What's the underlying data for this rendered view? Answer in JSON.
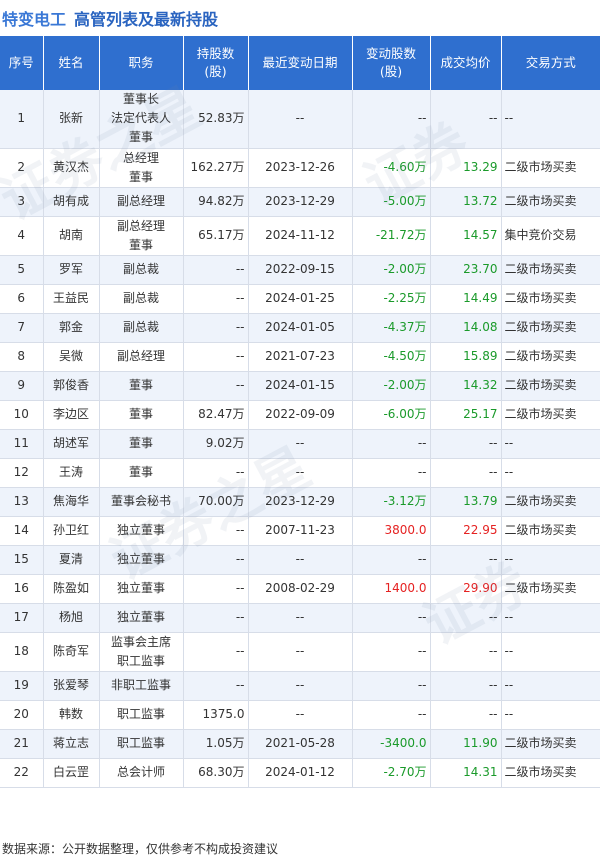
{
  "header": {
    "company": "特变电工",
    "subtitle": "高管列表及最新持股"
  },
  "columns": [
    "序号",
    "姓名",
    "职务",
    "持股数\n(股)",
    "最近变动日期",
    "变动股数\n(股)",
    "成交均价",
    "交易方式"
  ],
  "rows": [
    {
      "no": "1",
      "name": "张新",
      "role": "董事长\n法定代表人\n董事",
      "shares": "52.83万",
      "date": "--",
      "change": "--",
      "price": "--",
      "method": "--",
      "dir": ""
    },
    {
      "no": "2",
      "name": "黄汉杰",
      "role": "总经理\n董事",
      "shares": "162.27万",
      "date": "2023-12-26",
      "change": "-4.60万",
      "price": "13.29",
      "method": "二级市场买卖",
      "dir": "down"
    },
    {
      "no": "3",
      "name": "胡有成",
      "role": "副总经理",
      "shares": "94.82万",
      "date": "2023-12-29",
      "change": "-5.00万",
      "price": "13.72",
      "method": "二级市场买卖",
      "dir": "down"
    },
    {
      "no": "4",
      "name": "胡南",
      "role": "副总经理\n董事",
      "shares": "65.17万",
      "date": "2024-11-12",
      "change": "-21.72万",
      "price": "14.57",
      "method": "集中竞价交易",
      "dir": "down"
    },
    {
      "no": "5",
      "name": "罗军",
      "role": "副总裁",
      "shares": "--",
      "date": "2022-09-15",
      "change": "-2.00万",
      "price": "23.70",
      "method": "二级市场买卖",
      "dir": "down"
    },
    {
      "no": "6",
      "name": "王益民",
      "role": "副总裁",
      "shares": "--",
      "date": "2024-01-25",
      "change": "-2.25万",
      "price": "14.49",
      "method": "二级市场买卖",
      "dir": "down"
    },
    {
      "no": "7",
      "name": "郭金",
      "role": "副总裁",
      "shares": "--",
      "date": "2024-01-05",
      "change": "-4.37万",
      "price": "14.08",
      "method": "二级市场买卖",
      "dir": "down"
    },
    {
      "no": "8",
      "name": "吴微",
      "role": "副总经理",
      "shares": "--",
      "date": "2021-07-23",
      "change": "-4.50万",
      "price": "15.89",
      "method": "二级市场买卖",
      "dir": "down"
    },
    {
      "no": "9",
      "name": "郭俊香",
      "role": "董事",
      "shares": "--",
      "date": "2024-01-15",
      "change": "-2.00万",
      "price": "14.32",
      "method": "二级市场买卖",
      "dir": "down"
    },
    {
      "no": "10",
      "name": "李边区",
      "role": "董事",
      "shares": "82.47万",
      "date": "2022-09-09",
      "change": "-6.00万",
      "price": "25.17",
      "method": "二级市场买卖",
      "dir": "down"
    },
    {
      "no": "11",
      "name": "胡述军",
      "role": "董事",
      "shares": "9.02万",
      "date": "--",
      "change": "--",
      "price": "--",
      "method": "--",
      "dir": ""
    },
    {
      "no": "12",
      "name": "王涛",
      "role": "董事",
      "shares": "--",
      "date": "--",
      "change": "--",
      "price": "--",
      "method": "--",
      "dir": ""
    },
    {
      "no": "13",
      "name": "焦海华",
      "role": "董事会秘书",
      "shares": "70.00万",
      "date": "2023-12-29",
      "change": "-3.12万",
      "price": "13.79",
      "method": "二级市场买卖",
      "dir": "down"
    },
    {
      "no": "14",
      "name": "孙卫红",
      "role": "独立董事",
      "shares": "--",
      "date": "2007-11-23",
      "change": "3800.0",
      "price": "22.95",
      "method": "二级市场买卖",
      "dir": "up"
    },
    {
      "no": "15",
      "name": "夏清",
      "role": "独立董事",
      "shares": "--",
      "date": "--",
      "change": "--",
      "price": "--",
      "method": "--",
      "dir": ""
    },
    {
      "no": "16",
      "name": "陈盈如",
      "role": "独立董事",
      "shares": "--",
      "date": "2008-02-29",
      "change": "1400.0",
      "price": "29.90",
      "method": "二级市场买卖",
      "dir": "up"
    },
    {
      "no": "17",
      "name": "杨旭",
      "role": "独立董事",
      "shares": "--",
      "date": "--",
      "change": "--",
      "price": "--",
      "method": "--",
      "dir": ""
    },
    {
      "no": "18",
      "name": "陈奇军",
      "role": "监事会主席\n职工监事",
      "shares": "--",
      "date": "--",
      "change": "--",
      "price": "--",
      "method": "--",
      "dir": ""
    },
    {
      "no": "19",
      "name": "张爱琴",
      "role": "非职工监事",
      "shares": "--",
      "date": "--",
      "change": "--",
      "price": "--",
      "method": "--",
      "dir": ""
    },
    {
      "no": "20",
      "name": "韩数",
      "role": "职工监事",
      "shares": "1375.0",
      "date": "--",
      "change": "--",
      "price": "--",
      "method": "--",
      "dir": ""
    },
    {
      "no": "21",
      "name": "蒋立志",
      "role": "职工监事",
      "shares": "1.05万",
      "date": "2021-05-28",
      "change": "-3400.0",
      "price": "11.90",
      "method": "二级市场买卖",
      "dir": "down"
    },
    {
      "no": "22",
      "name": "白云罡",
      "role": "总会计师",
      "shares": "68.30万",
      "date": "2024-01-12",
      "change": "-2.70万",
      "price": "14.31",
      "method": "二级市场买卖",
      "dir": "down"
    }
  ],
  "colors": {
    "header_bg": "#2f6fcf",
    "stripe": "#eef3fb",
    "decrease": "#1a9a2a",
    "increase": "#e52222",
    "title": "#3a78d6"
  },
  "footer": "数据来源：公开数据整理，仅供参考不构成投资建议"
}
